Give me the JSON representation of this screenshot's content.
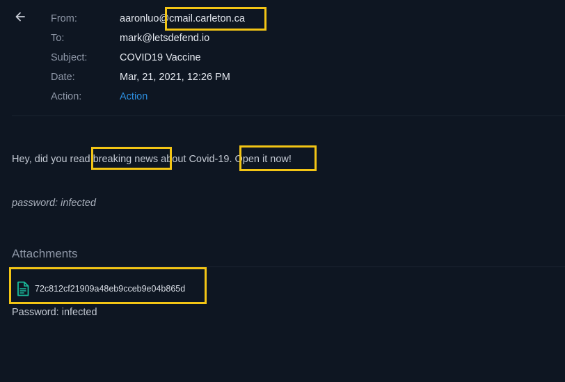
{
  "header": {
    "from_label": "From:",
    "from_value": "aaronluo@cmail.carleton.ca",
    "to_label": "To:",
    "to_value": "mark@letsdefend.io",
    "subject_label": "Subject:",
    "subject_value": "COVID19 Vaccine",
    "date_label": "Date:",
    "date_value": "Mar, 21, 2021, 12:26 PM",
    "action_label": "Action:",
    "action_value": "Action"
  },
  "body": {
    "line1": "Hey, did you read breaking news about Covid-19. Open it now!",
    "line2": "password: infected"
  },
  "attachments": {
    "title": "Attachments",
    "file_name": "72c812cf21909a48eb9cceb9e04b865d",
    "note": "Password: infected"
  },
  "icons": {
    "back": "arrow-left-icon",
    "file": "file-document-icon"
  },
  "colors": {
    "background": "#0e1622",
    "link": "#2d8fe0",
    "attachment_icon": "#1abc9c",
    "highlight": "#f3c515"
  }
}
